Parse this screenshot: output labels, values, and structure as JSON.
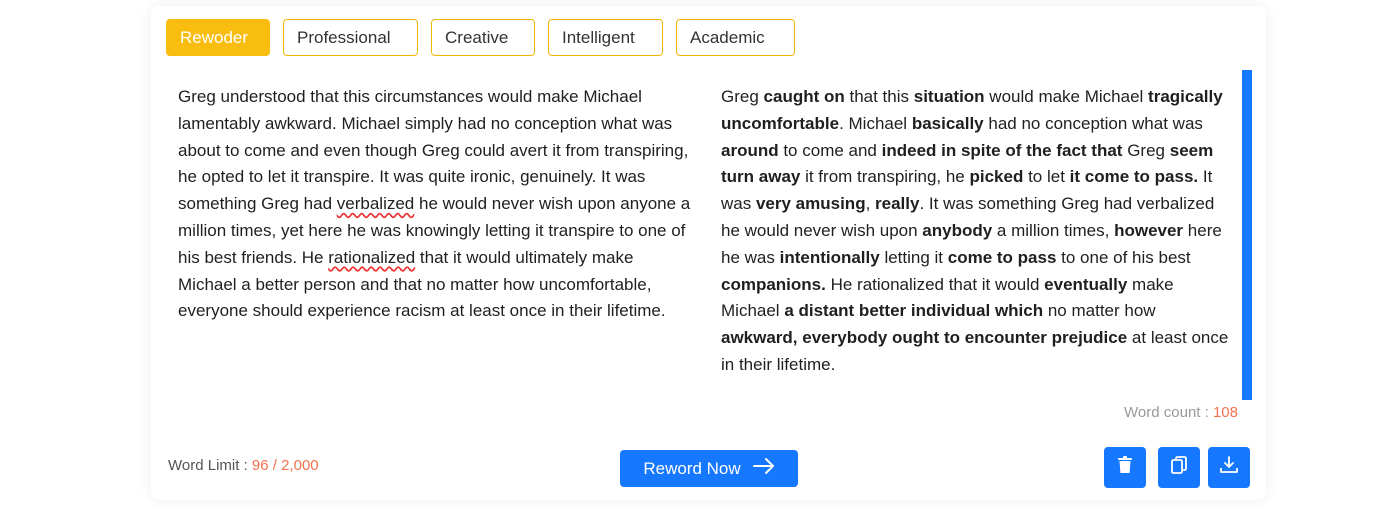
{
  "tabs": [
    {
      "label": "Rewoder",
      "active": true
    },
    {
      "label": "Professional",
      "active": false
    },
    {
      "label": "Creative",
      "active": false
    },
    {
      "label": "Intelligent",
      "active": false
    },
    {
      "label": "Academic",
      "active": false
    }
  ],
  "input_segments": [
    {
      "text": "Greg understood that this circumstances would make Michael lamentably awkward. Michael simply had no conception what was about to come and even though Greg could avert it from transpiring, he opted to let it transpire. It was quite ironic, genuinely. It was something Greg had ",
      "style": "plain"
    },
    {
      "text": "verbalized",
      "style": "misspelled"
    },
    {
      "text": " he would never wish upon anyone a million times, yet here he was knowingly letting it transpire to one of his best friends. He ",
      "style": "plain"
    },
    {
      "text": "rationalized",
      "style": "misspelled"
    },
    {
      "text": " that it would ultimately make Michael a better person and that no matter how uncomfortable, everyone should experience racism at least once in their lifetime.",
      "style": "plain"
    }
  ],
  "output_segments": [
    {
      "text": "Greg ",
      "style": "plain"
    },
    {
      "text": "caught on",
      "style": "changed"
    },
    {
      "text": " that this ",
      "style": "plain"
    },
    {
      "text": "situation",
      "style": "changed"
    },
    {
      "text": " would make Michael ",
      "style": "plain"
    },
    {
      "text": "tragically uncomfortable",
      "style": "changed"
    },
    {
      "text": ". Michael ",
      "style": "plain"
    },
    {
      "text": "basically",
      "style": "changed"
    },
    {
      "text": " had no conception what was ",
      "style": "plain"
    },
    {
      "text": "around",
      "style": "changed"
    },
    {
      "text": " to come and ",
      "style": "plain"
    },
    {
      "text": "indeed in spite of the fact that",
      "style": "changed"
    },
    {
      "text": " Greg ",
      "style": "plain"
    },
    {
      "text": "seem turn away",
      "style": "changed"
    },
    {
      "text": " it from transpiring, he ",
      "style": "plain"
    },
    {
      "text": "picked",
      "style": "changed"
    },
    {
      "text": " to let ",
      "style": "plain"
    },
    {
      "text": "it come to pass.",
      "style": "changed"
    },
    {
      "text": " It was ",
      "style": "plain"
    },
    {
      "text": "very amusing",
      "style": "changed"
    },
    {
      "text": ", ",
      "style": "plain"
    },
    {
      "text": "really",
      "style": "changed"
    },
    {
      "text": ". It was something Greg had verbalized he would never wish upon ",
      "style": "plain"
    },
    {
      "text": "anybody",
      "style": "changed"
    },
    {
      "text": " a million times, ",
      "style": "plain"
    },
    {
      "text": "however",
      "style": "changed"
    },
    {
      "text": " here he was ",
      "style": "plain"
    },
    {
      "text": "intentionally",
      "style": "changed"
    },
    {
      "text": " letting it ",
      "style": "plain"
    },
    {
      "text": "come to pass",
      "style": "changed"
    },
    {
      "text": " to one of his best ",
      "style": "plain"
    },
    {
      "text": "companions.",
      "style": "changed"
    },
    {
      "text": " He rationalized that it would ",
      "style": "plain"
    },
    {
      "text": "eventually",
      "style": "changed"
    },
    {
      "text": " make Michael ",
      "style": "plain"
    },
    {
      "text": "a distant better individual which",
      "style": "changed"
    },
    {
      "text": " no matter how ",
      "style": "plain"
    },
    {
      "text": "awkward, everybody ought to encounter prejudice",
      "style": "changed"
    },
    {
      "text": " at least once in their lifetime.",
      "style": "plain"
    }
  ],
  "word_count": {
    "label": "Word count : ",
    "value": "108"
  },
  "word_limit": {
    "label": "Word Limit : ",
    "value": "96 / 2,000"
  },
  "reword_button": {
    "label": "Reword Now",
    "icon": "arrow-right-icon"
  },
  "action_icons": [
    "trash-icon",
    "copy-icon",
    "download-icon"
  ],
  "colors": {
    "accent_yellow": "#f8bd0f",
    "primary_blue": "#1677ff",
    "count_orange": "#f2724e"
  }
}
